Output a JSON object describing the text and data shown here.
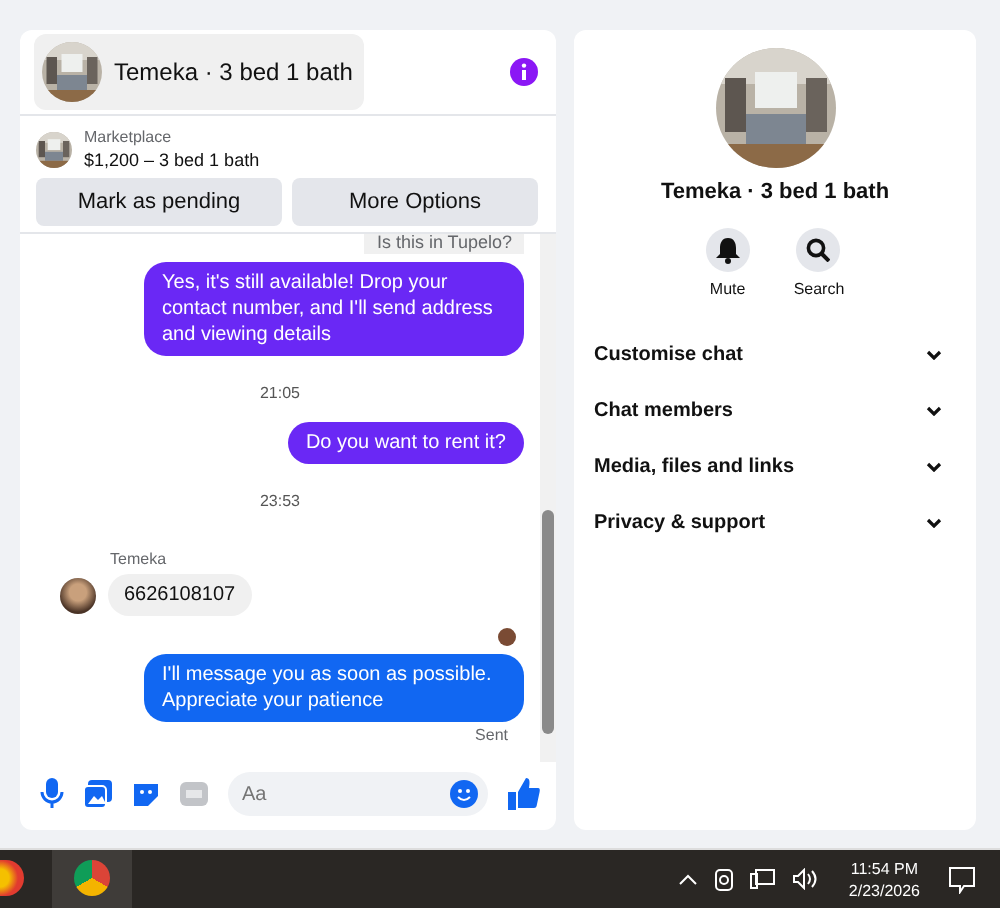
{
  "chat": {
    "title": "Temeka · 3 bed 1 bath",
    "listing": {
      "source": "Marketplace",
      "summary": "$1,200 – 3 bed 1 bath"
    },
    "actions": [
      "Mark as pending",
      "More Options"
    ],
    "messages": [
      {
        "kind": "incoming-cut",
        "text": "Is this in Tupelo?"
      },
      {
        "kind": "outgoing",
        "text": "Yes, it's still available! Drop your contact number, and I'll send address and viewing details",
        "color": "#6a28f5"
      },
      {
        "kind": "time",
        "text": "21:05"
      },
      {
        "kind": "outgoing",
        "text": "Do you want to rent it?",
        "color": "#6a28f5"
      },
      {
        "kind": "time",
        "text": "23:53"
      },
      {
        "kind": "sender",
        "text": "Temeka"
      },
      {
        "kind": "incoming",
        "text": "6626108107"
      },
      {
        "kind": "read"
      },
      {
        "kind": "outgoing",
        "text": "I'll message you as soon as possible. Appreciate your patience",
        "color": "#1167f2"
      },
      {
        "kind": "status",
        "text": "Sent"
      }
    ],
    "composer": {
      "placeholder": "Aa"
    }
  },
  "details": {
    "title": "Temeka · 3 bed 1 bath",
    "quick_actions": [
      {
        "kind": "mute",
        "label": "Mute"
      },
      {
        "kind": "search",
        "label": "Search"
      }
    ],
    "sections": [
      {
        "label": "Customise chat",
        "expanded": false
      },
      {
        "label": "Chat members",
        "expanded": false
      },
      {
        "label": "Media, files and links",
        "expanded": false
      },
      {
        "label": "Privacy & support",
        "expanded": false
      }
    ]
  },
  "taskbar": {
    "time": "11:54 PM",
    "date": "2/23/2026"
  }
}
